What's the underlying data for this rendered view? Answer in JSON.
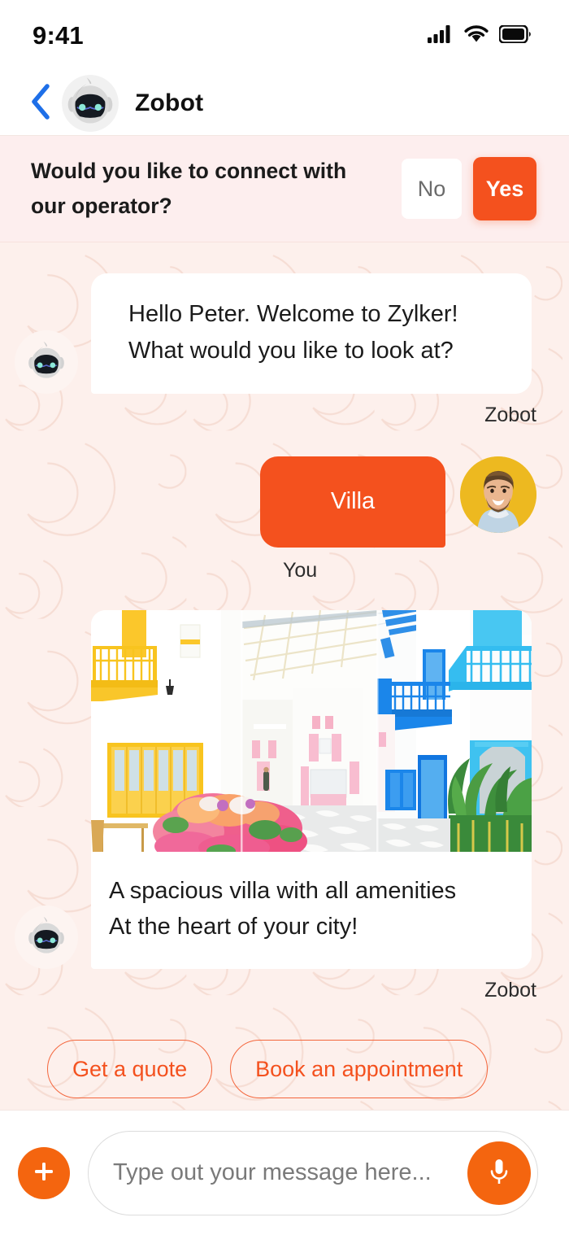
{
  "status_bar": {
    "time": "9:41",
    "icons": [
      "cellular-signal-icon",
      "wifi-icon",
      "battery-icon"
    ]
  },
  "nav": {
    "back_icon": "chevron-left-icon",
    "avatar": "zobot-avatar",
    "title": "Zobot"
  },
  "operator_prompt": {
    "question": "Would you like to connect with our operator?",
    "no_label": "No",
    "yes_label": "Yes"
  },
  "messages": [
    {
      "sender": "Zobot",
      "type": "text",
      "text": "Hello Peter. Welcome to Zylker! What would you like to look at?"
    },
    {
      "sender": "You",
      "type": "text",
      "text": "Villa"
    },
    {
      "sender": "Zobot",
      "type": "card",
      "image_alt": "villa-photo",
      "caption_line1": "A spacious villa with all amenities",
      "caption_line2": "At the heart of your city!"
    }
  ],
  "suggestions": [
    {
      "label": "Get a quote"
    },
    {
      "label": "Book an appointment"
    }
  ],
  "composer": {
    "attach_icon": "plus-icon",
    "placeholder": "Type out your message here...",
    "value": "",
    "mic_icon": "microphone-icon"
  },
  "colors": {
    "accent_orange": "#F4511E",
    "chat_background": "#FDF0EC",
    "operator_bar": "#FDEEEE",
    "bubble_white": "#FFFFFF",
    "back_arrow_blue": "#1E6FE8",
    "user_avatar_bg": "#EDB920"
  }
}
